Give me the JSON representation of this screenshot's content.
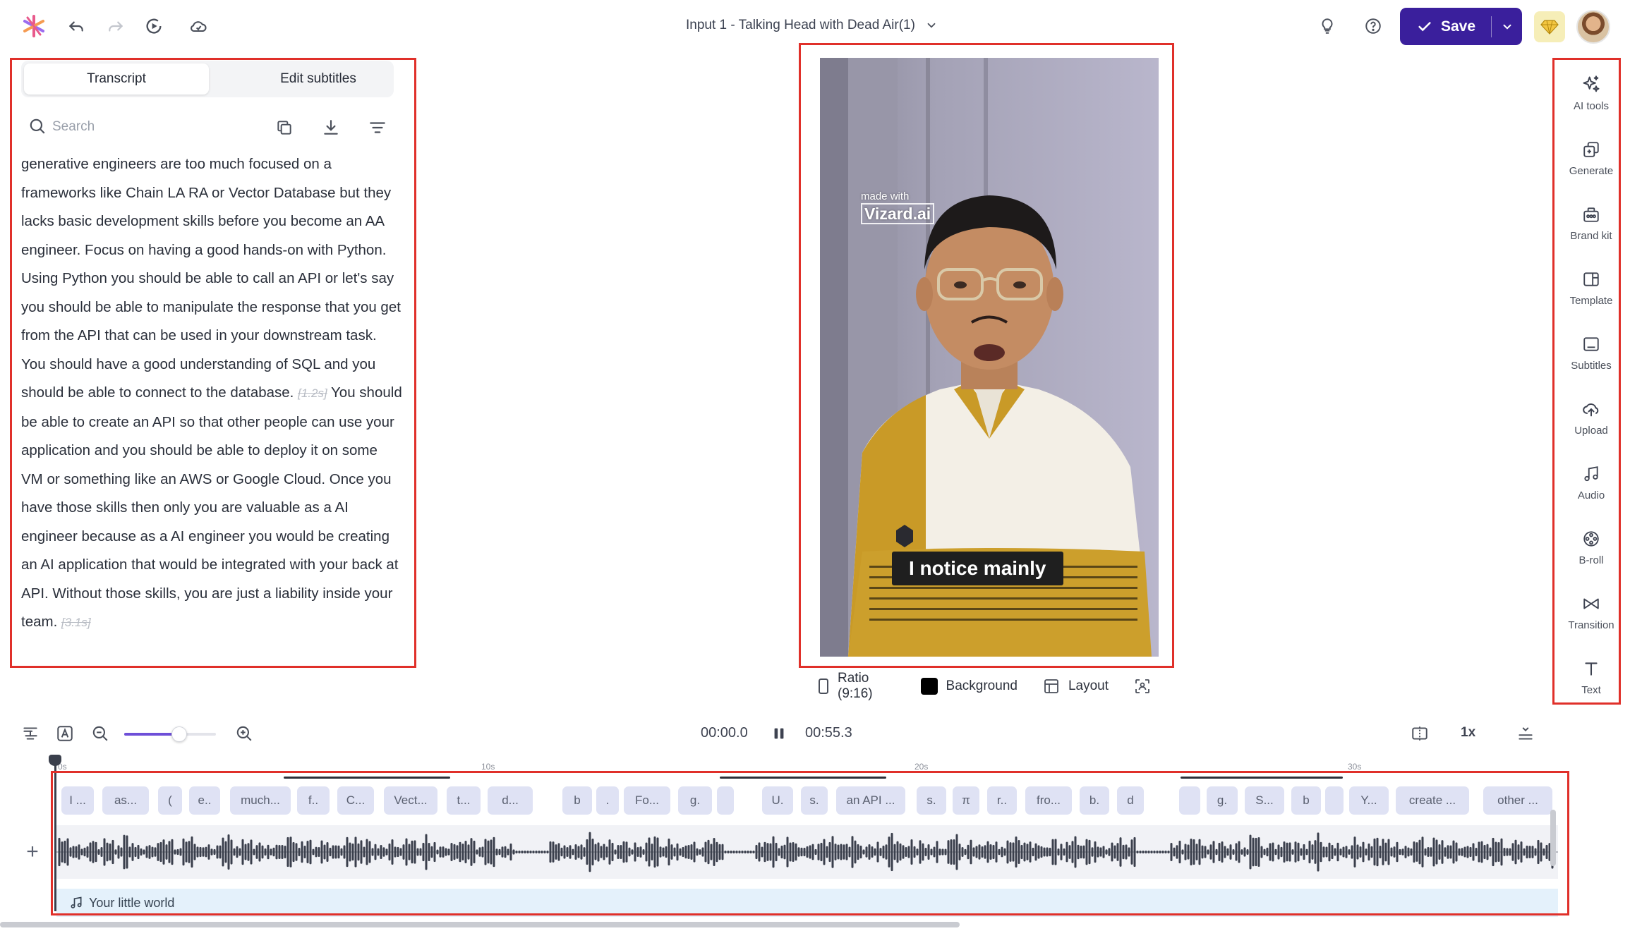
{
  "header": {
    "title": "Input 1 - Talking Head with Dead Air(1)",
    "save_label": "Save"
  },
  "transcript_panel": {
    "tabs": [
      "Transcript",
      "Edit subtitles"
    ],
    "search_placeholder": "Search",
    "text_before_pause1": "generative engineers are too much focused on a frameworks like Chain LA RA or Vector Database but they lacks basic development skills before you become an AA engineer. Focus on having a good hands-on with Python. Using Python you should be able to call an API or let's say you should be able to manipulate the response that you get from the API that can be used in your downstream task. You should have a good understanding of SQL and you should be able to connect to the database.",
    "pause1": "[1.2s]",
    "text_after_pause1": "You should be able to create an API so that other people can use your application and you should be able to deploy it on some VM or something like an AWS or Google Cloud. Once you have those skills then only you are valuable as a AI engineer because as a AI engineer you would be creating an AI application that would be integrated with your back at API. Without those skills, you are just a liability inside your team.",
    "pause2": "[3.1s]"
  },
  "video": {
    "watermark_top": "made with",
    "watermark_brand": "Vizard.ai",
    "subtitle": "I notice mainly",
    "controls": {
      "ratio": "Ratio (9:16)",
      "background": "Background",
      "layout": "Layout"
    }
  },
  "sidebar": {
    "items": [
      {
        "label": "AI tools",
        "icon": "ai-tools-icon"
      },
      {
        "label": "Generate",
        "icon": "generate-icon"
      },
      {
        "label": "Brand kit",
        "icon": "brand-kit-icon"
      },
      {
        "label": "Template",
        "icon": "template-icon"
      },
      {
        "label": "Subtitles",
        "icon": "subtitles-icon"
      },
      {
        "label": "Upload",
        "icon": "upload-icon"
      },
      {
        "label": "Audio",
        "icon": "audio-icon"
      },
      {
        "label": "B-roll",
        "icon": "b-roll-icon"
      },
      {
        "label": "Transition",
        "icon": "transition-icon"
      },
      {
        "label": "Text",
        "icon": "text-icon"
      }
    ]
  },
  "timeline": {
    "current_time": "00:00.0",
    "total_time": "00:55.3",
    "speed": "1x",
    "zoom_fraction": 0.6,
    "ruler_labels": [
      "0s",
      "10s",
      "20s",
      "30s"
    ],
    "word_chips": [
      "I ...",
      "as...",
      "(",
      "e..",
      "much...",
      "f..",
      "C...",
      "Vect...",
      "t...",
      "d...",
      "b",
      ".",
      "Fo...",
      "g.",
      "",
      "U.",
      "s.",
      "an API ...",
      "s.",
      "π",
      "r..",
      "fro...",
      "b.",
      "d",
      "",
      "g.",
      "S...",
      "b",
      "",
      "Y...",
      "create ...",
      "other ..."
    ],
    "music_track": "Your little world"
  },
  "colors": {
    "accent": "#3a1f9c",
    "highlight_border": "#e0302a",
    "chip_bg": "#dfe2f4",
    "zoom_fill": "#6e4fd8"
  }
}
